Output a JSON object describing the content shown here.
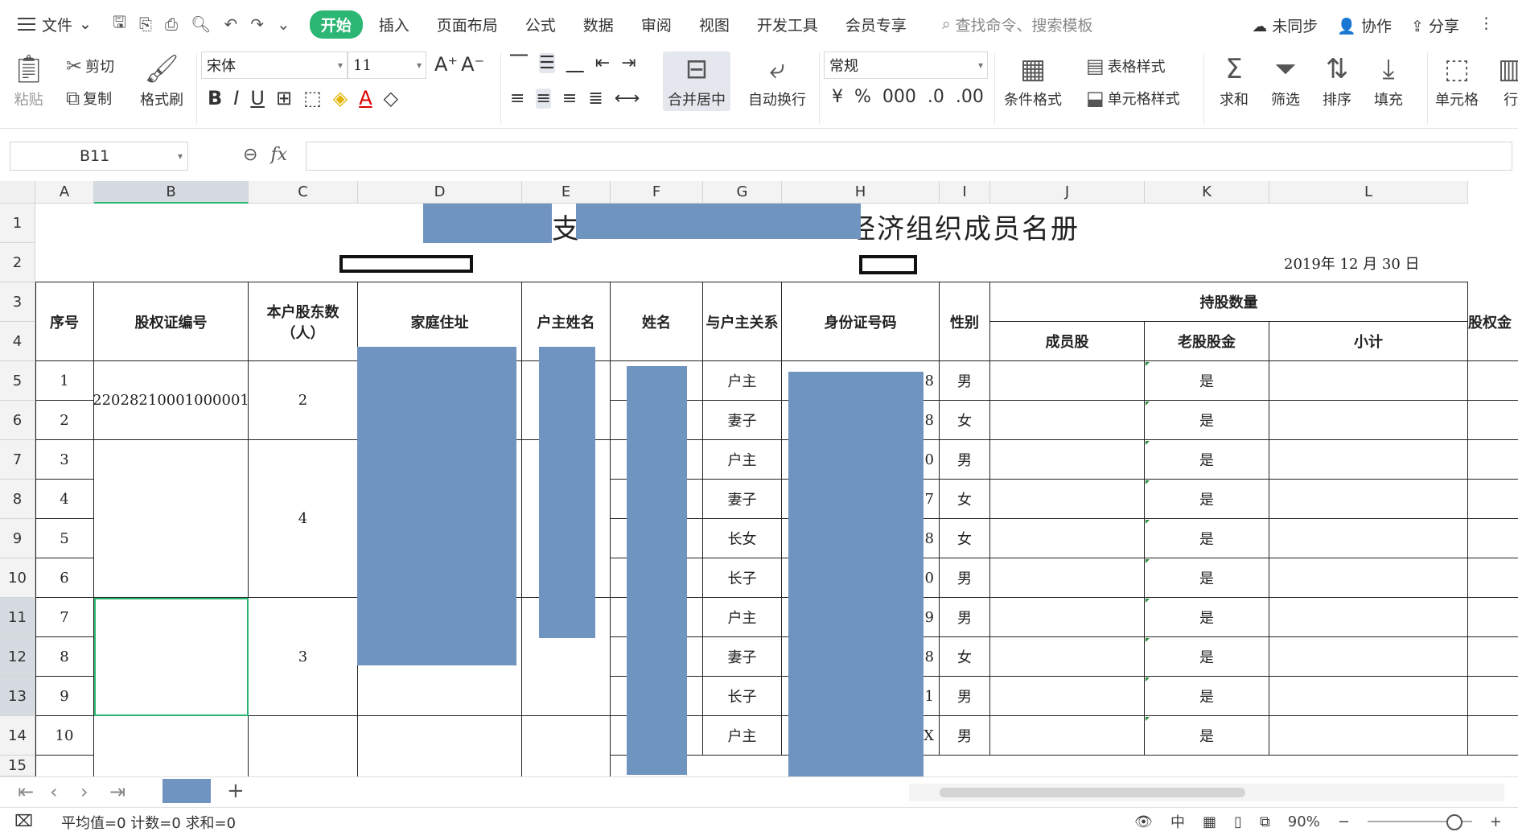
{
  "menu": {
    "file": "文件",
    "tabs": [
      "开始",
      "插入",
      "页面布局",
      "公式",
      "数据",
      "审阅",
      "视图",
      "开发工具",
      "会员专享"
    ],
    "active_tab": "开始",
    "search_placeholder": "查找命令、搜索模板",
    "actions": [
      "未同步",
      "协作",
      "分享"
    ]
  },
  "ribbon": {
    "paste": "粘贴",
    "cut": "剪切",
    "copy": "复制",
    "format_painter": "格式刷",
    "font_name": "宋体",
    "font_size": "11",
    "merge_center": "合并居中",
    "wrap_text": "自动换行",
    "number_format": "常规",
    "conditional_format": "条件格式",
    "table_style": "表格样式",
    "cell_style": "单元格样式",
    "sum": "求和",
    "filter": "筛选",
    "sort": "排序",
    "fill": "填充",
    "cell": "单元格",
    "row_col": "行"
  },
  "formula_bar": {
    "name_box": "B11",
    "fx": "fx",
    "value": ""
  },
  "columns": [
    "A",
    "B",
    "C",
    "D",
    "E",
    "F",
    "G",
    "H",
    "I",
    "J",
    "K",
    "L"
  ],
  "rows": [
    "1",
    "2",
    "3",
    "4",
    "5",
    "6",
    "7",
    "8",
    "9",
    "10",
    "11",
    "12",
    "13",
    "14",
    "15"
  ],
  "sheet": {
    "title_left": "支",
    "title_right": "经济组织成员名册",
    "date": "2019年 12   月 30 日",
    "headers": {
      "seq": "序号",
      "cert_no": "股权证编号",
      "household_count": "本户股东数（人）",
      "address": "家庭住址",
      "head_name": "户主姓名",
      "name": "姓名",
      "relation": "与户主关系",
      "id_no": "身份证号码",
      "gender": "性别",
      "shares": "持股数量",
      "member_share": "成员股",
      "old_share": "老股股金",
      "subtotal": "小计",
      "equity": "股权金"
    },
    "groups": [
      {
        "cert_no": "22028210001000001",
        "count": "2"
      },
      {
        "cert_no": "",
        "count": "4"
      },
      {
        "cert_no": "",
        "count": "3"
      }
    ],
    "records": [
      {
        "seq": "1",
        "relation": "户主",
        "id_tail": "8",
        "gender": "男",
        "old_share": "是"
      },
      {
        "seq": "2",
        "relation": "妻子",
        "id_tail": "8",
        "gender": "女",
        "old_share": "是"
      },
      {
        "seq": "3",
        "relation": "户主",
        "id_tail": "0",
        "gender": "男",
        "old_share": "是"
      },
      {
        "seq": "4",
        "relation": "妻子",
        "id_tail": "7",
        "gender": "女",
        "old_share": "是"
      },
      {
        "seq": "5",
        "relation": "长女",
        "id_tail": "8",
        "gender": "女",
        "old_share": "是"
      },
      {
        "seq": "6",
        "relation": "长子",
        "id_tail": "0",
        "gender": "男",
        "old_share": "是"
      },
      {
        "seq": "7",
        "relation": "户主",
        "id_tail": "9",
        "gender": "男",
        "old_share": "是"
      },
      {
        "seq": "8",
        "relation": "妻子",
        "id_tail": "8",
        "gender": "女",
        "old_share": "是"
      },
      {
        "seq": "9",
        "relation": "长子",
        "id_tail": "1",
        "gender": "男",
        "old_share": "是"
      },
      {
        "seq": "10",
        "relation": "户主",
        "id_tail": "X",
        "gender": "男",
        "old_share": "是"
      }
    ]
  },
  "status": {
    "stats": "平均值=0  计数=0  求和=0",
    "zoom": "90%"
  },
  "colors": {
    "accent": "#2bb673",
    "redaction": "#7094c0"
  }
}
